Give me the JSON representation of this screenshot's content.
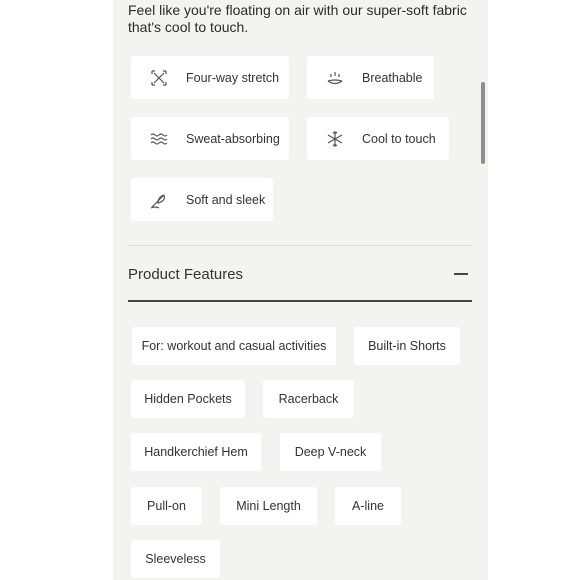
{
  "intro_text": "Feel like you're floating on air with our super-soft fabric that's cool to touch.",
  "fabric_features": [
    {
      "label": "Four-way stretch",
      "icon": "stretch-icon"
    },
    {
      "label": "Breathable",
      "icon": "breathable-icon"
    },
    {
      "label": "Sweat-absorbing",
      "icon": "sweat-absorbing-icon"
    },
    {
      "label": "Cool to touch",
      "icon": "snowflake-icon"
    },
    {
      "label": "Soft and sleek",
      "icon": "feather-icon"
    }
  ],
  "product_features": {
    "title": "Product Features",
    "tags": [
      "For: workout and casual activities",
      "Built-in Shorts",
      "Hidden Pockets",
      "Racerback",
      "Handkerchief Hem",
      "Deep V-neck",
      "Pull-on",
      "Mini Length",
      "A-line",
      "Sleeveless"
    ]
  },
  "colors": {
    "panel_bg": "#f3f3f2",
    "chip_bg": "#ffffff",
    "text": "#333333"
  }
}
